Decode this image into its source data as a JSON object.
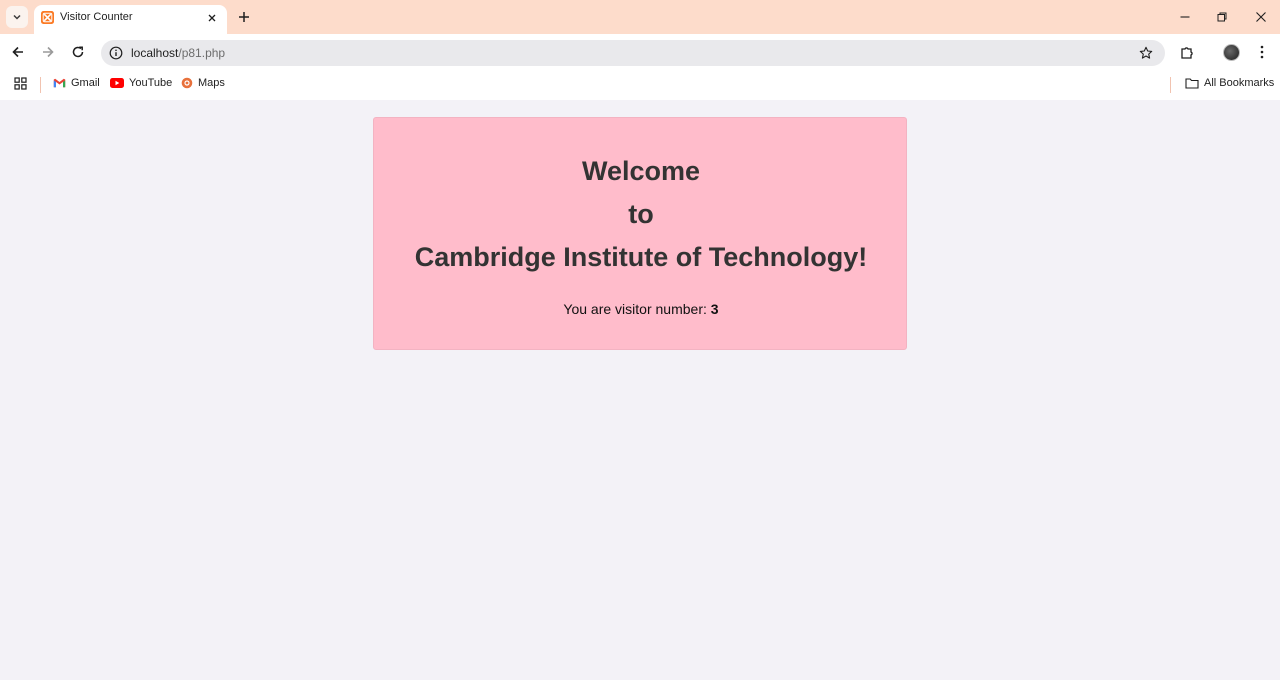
{
  "browser": {
    "tab": {
      "title": "Visitor Counter"
    },
    "url": {
      "host": "localhost",
      "path": "/p81.php"
    },
    "bookmarks": [
      {
        "label": "Gmail"
      },
      {
        "label": "YouTube"
      },
      {
        "label": "Maps"
      }
    ],
    "all_bookmarks_label": "All Bookmarks"
  },
  "page": {
    "heading_lines": [
      "Welcome",
      "to",
      "Cambridge Institute of Technology!"
    ],
    "visitor_label": "You are visitor number: ",
    "visitor_count": "3",
    "card_color": "#ffbccb",
    "background_color": "#f3f2f7"
  },
  "icons": {
    "tab_search": "chevron-down-icon",
    "favicon": "xampp-icon",
    "close": "close-icon",
    "new_tab": "plus-icon",
    "back": "arrow-left-icon",
    "forward": "arrow-right-icon",
    "reload": "reload-icon",
    "site_info": "info-icon",
    "bookmark_star": "star-icon",
    "extensions": "puzzle-icon",
    "menu": "kebab-menu-icon",
    "apps": "apps-grid-icon",
    "folder": "folder-icon"
  }
}
